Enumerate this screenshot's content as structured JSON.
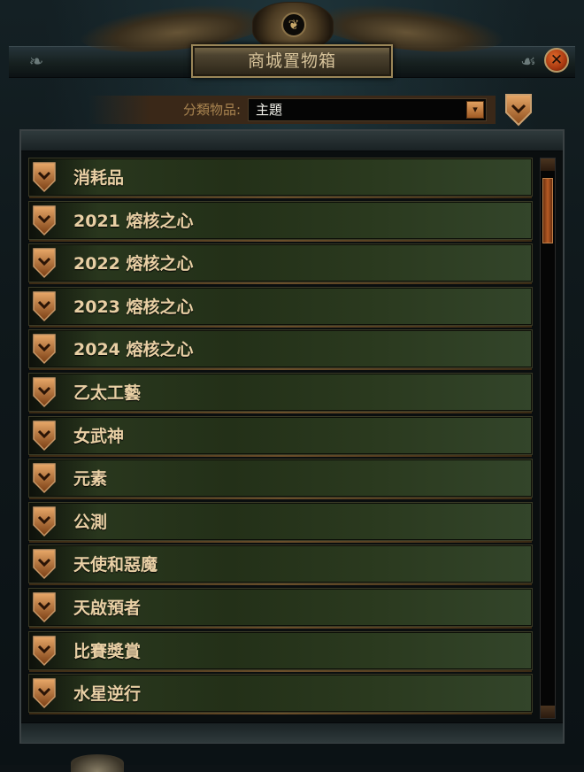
{
  "window": {
    "title": "商城置物箱",
    "crest_icon": "wolf-emblem-icon",
    "close_icon": "close-icon",
    "close_glyph": "✕"
  },
  "filter": {
    "label": "分類物品:",
    "selected": "主題",
    "dropdown_icon": "chevron-down-icon",
    "dropdown_glyph": "▾",
    "collapse_all_icon": "chevron-down-icon"
  },
  "categories": [
    {
      "label": "消耗品"
    },
    {
      "label": "2021 熔核之心"
    },
    {
      "label": "2022 熔核之心"
    },
    {
      "label": "2023 熔核之心"
    },
    {
      "label": "2024 熔核之心"
    },
    {
      "label": "乙太工藝"
    },
    {
      "label": "女武神"
    },
    {
      "label": "元素"
    },
    {
      "label": "公測"
    },
    {
      "label": "天使和惡魔"
    },
    {
      "label": "天啟預者"
    },
    {
      "label": "比賽獎賞"
    },
    {
      "label": "水星逆行"
    }
  ],
  "colors": {
    "accent_orange": "#b85a24",
    "label_gold": "#e8cfa4",
    "title_gold": "#d7c39a",
    "row_green": "#2c3a20"
  }
}
